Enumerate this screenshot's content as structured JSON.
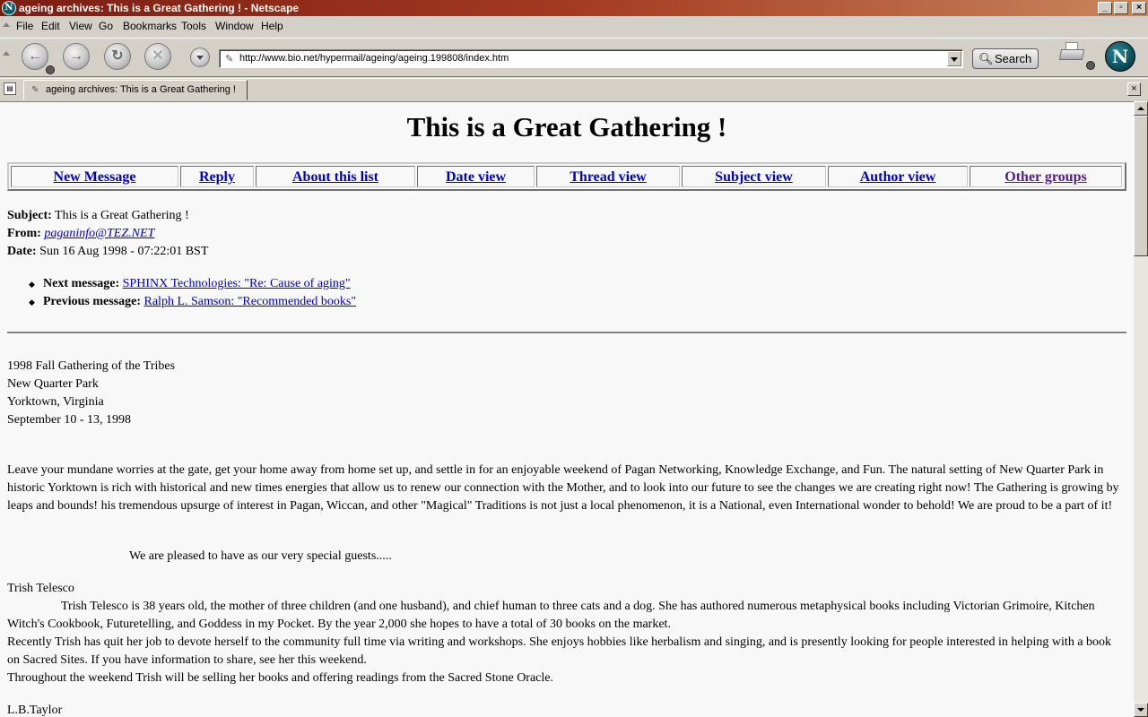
{
  "window": {
    "title": "ageing archives: This is a Great Gathering ! - Netscape"
  },
  "menu": [
    "File",
    "Edit",
    "View",
    "Go",
    "Bookmarks",
    "Tools",
    "Window",
    "Help"
  ],
  "navbar": {
    "url": "http://www.bio.net/hypermail/ageing/ageing.199808/index.htm",
    "search_label": "Search"
  },
  "tab": {
    "label": "ageing archives: This is a Great Gathering !"
  },
  "page": {
    "heading": "This is a Great Gathering !",
    "nav": [
      "New Message",
      "Reply",
      "About this list",
      "Date view",
      "Thread view",
      "Subject view",
      "Author view",
      "Other groups"
    ],
    "subject_label": "Subject:",
    "subject": "This is a Great Gathering !",
    "from_label": "From:",
    "from": "paganinfo@TEZ.NET",
    "date_label": "Date:",
    "date": "Sun 16 Aug 1998 - 07:22:01 BST",
    "next_label": "Next message:",
    "next": "SPHINX Technologies: \"Re: Cause of aging\"",
    "prev_label": "Previous message:",
    "prev": "Ralph L. Samson: \"Recommended books\"",
    "event_lines": [
      "1998 Fall Gathering of the Tribes",
      "New Quarter Park",
      "Yorktown, Virginia",
      "September 10 - 13, 1998"
    ],
    "intro": "Leave your mundane worries at the gate, get your home away from home set up, and settle in for an enjoyable weekend of Pagan Networking, Knowledge Exchange, and Fun. The natural setting of New Quarter Park in historic Yorktown is rich with historical and new times energies that allow us to renew our connection with the Mother, and to look into our future to see the changes we are creating right now! The Gathering is growing by leaps and bounds! his tremendous upsurge of interest in Pagan, Wiccan, and other \"Magical\" Traditions is not just a local phenomenon, it is a National, even International wonder to behold! We are proud to be a part of it!",
    "guests_intro": "We are pleased to have as our very special guests.....",
    "guest1_name": "Trish Telesco",
    "guest1_p1": "Trish Telesco is 38 years old, the mother of three children (and one husband), and chief human to three cats and a dog. She has authored numerous metaphysical books including Victorian Grimoire, Kitchen Witch's Cookbook, Futuretelling, and Goddess in my Pocket. By the year 2,000 she hopes to have a total of 30 books on the market.",
    "guest1_p2": "Recently Trish has quit her job to devote herself to the community full time via writing and workshops. She enjoys hobbies like herbalism and singing, and is presently looking for people interested in helping with a book on Sacred Sites. If you have information to share, see her this weekend.",
    "guest1_p3": "Throughout the weekend Trish will be selling her books and offering readings from the Sacred Stone Oracle.",
    "guest2_name": "L.B.Taylor"
  }
}
